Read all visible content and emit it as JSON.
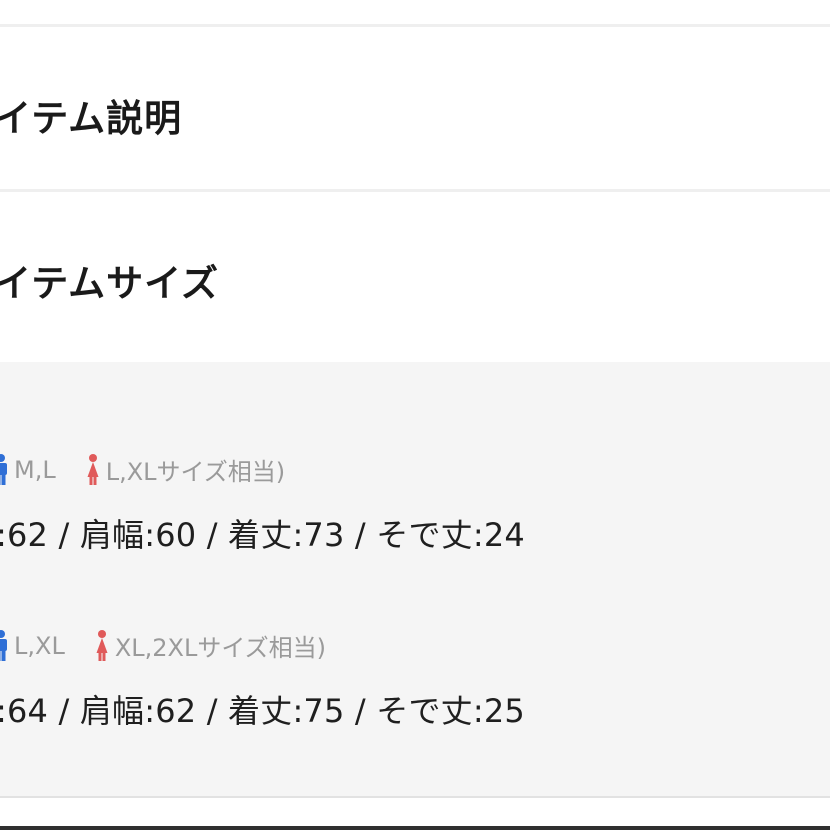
{
  "sections": {
    "description_title": "イテム説明",
    "size_title": "イテムサイズ"
  },
  "sizes": [
    {
      "male_size": "M,L",
      "female_size": "L,XLサイズ相当)",
      "measurements": ":62 / 肩幅:60 / 着丈:73 / そで丈:24"
    },
    {
      "male_size": "L,XL",
      "female_size": "XL,2XLサイズ相当)",
      "measurements": ":64 / 肩幅:62 / 着丈:75 / そで丈:25"
    }
  ],
  "colors": {
    "male_icon": "#2f6fd6",
    "female_icon": "#e05a5a",
    "panel_bg": "#f5f5f5"
  },
  "icons": {
    "male": "male-figure-icon",
    "female": "female-figure-icon"
  }
}
